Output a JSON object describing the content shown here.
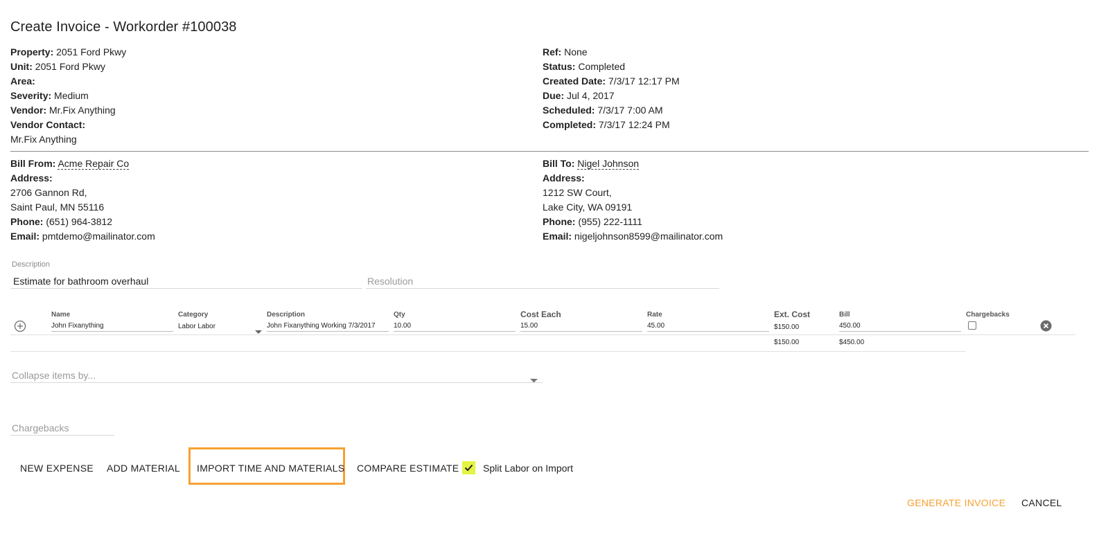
{
  "page": {
    "title": "Create Invoice - Workorder #100038"
  },
  "workorder_left": [
    {
      "label": "Property:",
      "value": "2051 Ford Pkwy"
    },
    {
      "label": "Unit:",
      "value": "2051 Ford Pkwy"
    },
    {
      "label": "Area:",
      "value": ""
    },
    {
      "label": "Severity:",
      "value": "Medium"
    },
    {
      "label": "Vendor:",
      "value": "Mr.Fix Anything"
    },
    {
      "label": "Vendor Contact:",
      "value": ""
    },
    {
      "label": "",
      "value": "Mr.Fix Anything"
    }
  ],
  "workorder_right": [
    {
      "label": "Ref:",
      "value": "None"
    },
    {
      "label": "Status:",
      "value": "Completed"
    },
    {
      "label": "Created Date:",
      "value": "7/3/17 12:17 PM"
    },
    {
      "label": "Due:",
      "value": "Jul 4, 2017"
    },
    {
      "label": "Scheduled:",
      "value": "7/3/17 7:00 AM"
    },
    {
      "label": "Completed:",
      "value": "7/3/17 12:24 PM"
    }
  ],
  "bill_from": {
    "label": "Bill From:",
    "name": "Acme Repair Co",
    "address_label": "Address:",
    "address_line1": "2706 Gannon Rd,",
    "address_line2": "Saint Paul, MN 55116",
    "phone_label": "Phone:",
    "phone": "(651) 964-3812",
    "email_label": "Email:",
    "email": "pmtdemo@mailinator.com"
  },
  "bill_to": {
    "label": "Bill To:",
    "name": "Nigel Johnson",
    "address_label": "Address:",
    "address_line1": "1212 SW Court,",
    "address_line2": "Lake City, WA 09191",
    "phone_label": "Phone:",
    "phone": "(955) 222-1111",
    "email_label": "Email:",
    "email": "nigeljohnson8599@mailinator.com"
  },
  "description_field": {
    "label": "Description",
    "value": "Estimate for bathroom overhaul"
  },
  "resolution_field": {
    "placeholder": "Resolution"
  },
  "table": {
    "headers": {
      "name": "Name",
      "category": "Category",
      "description": "Description",
      "qty": "Qty",
      "cost_each": "Cost Each",
      "rate": "Rate",
      "ext_cost": "Ext. Cost",
      "bill": "Bill",
      "chargebacks": "Chargebacks"
    },
    "row": {
      "name": "John Fixanything",
      "category": "Labor Labor",
      "description": "John Fixanything Working 7/3/2017",
      "qty": "10.00",
      "cost_each": "15.00",
      "rate": "45.00",
      "ext_cost": "$150.00",
      "bill": "450.00",
      "chargeback_checked": false
    },
    "totals": {
      "ext_cost": "$150.00",
      "bill": "$450.00"
    }
  },
  "collapse_select": {
    "placeholder": "Collapse items by..."
  },
  "chargebacks_field": {
    "placeholder": "Chargebacks"
  },
  "actions": {
    "new_expense": "NEW EXPENSE",
    "add_material": "ADD MATERIAL",
    "import_time": "IMPORT TIME AND MATERIALS",
    "compare_estimate": "COMPARE ESTIMATE",
    "split_labor_label": "Split Labor on Import",
    "split_labor_checked": true,
    "generate_invoice": "GENERATE INVOICE",
    "cancel": "CANCEL"
  },
  "colors": {
    "accent": "#f7a031",
    "checkbox_fill": "#e3f542",
    "text": "#212121",
    "muted": "#9a9a9a"
  },
  "icons": {
    "add_row": "plus-circle-icon",
    "remove_row": "close-circle-icon",
    "select_arrow": "caret-down-icon",
    "check": "checkmark-icon"
  }
}
